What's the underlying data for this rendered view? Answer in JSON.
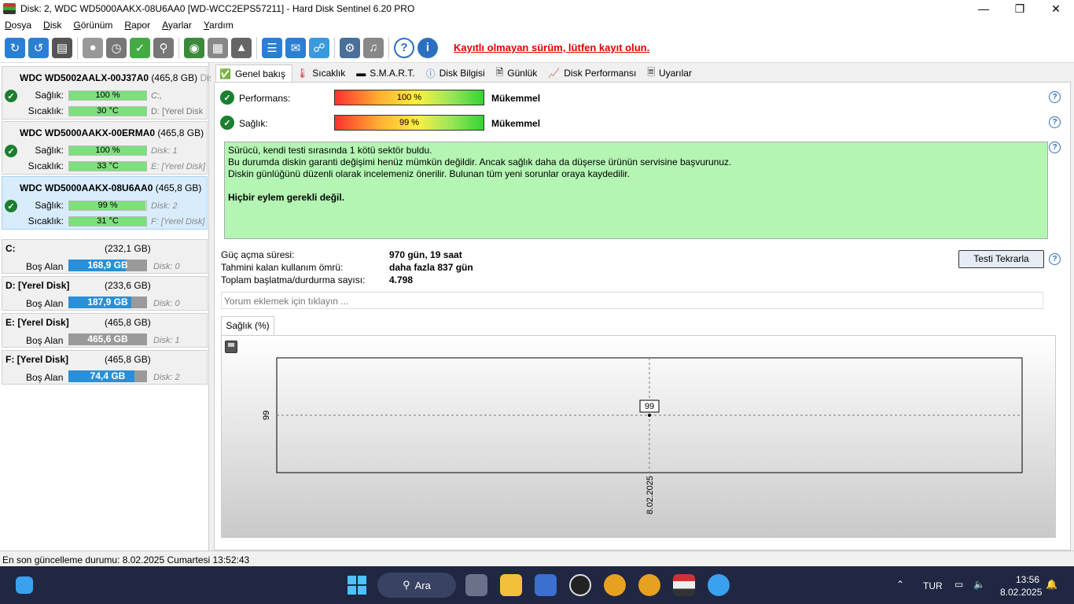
{
  "window": {
    "title": "Disk: 2, WDC WD5000AAKX-08U6AA0 [WD-WCC2EPS57211]  -  Hard Disk Sentinel 6.20 PRO"
  },
  "menu": [
    "Dosya",
    "Disk",
    "Görünüm",
    "Rapor",
    "Ayarlar",
    "Yardım"
  ],
  "toolbar": {
    "register_notice": "Kayıtlı olmayan sürüm, lütfen kayıt olun."
  },
  "labels": {
    "health": "Sağlık:",
    "temp": "Sıcaklık:",
    "free": "Boş Alan"
  },
  "disks": [
    {
      "model": "WDC WD5002AALX-00J37A0",
      "size": "(465,8 GB)",
      "trail": "Dis",
      "health": "100 %",
      "health_pct": 100,
      "temp": "30 °C",
      "side1": "C:,",
      "side2": "D: [Yerel Disk",
      "selected": false
    },
    {
      "model": "WDC WD5000AAKX-00ERMA0",
      "size": "(465,8 GB)",
      "trail": "",
      "health": "100 %",
      "health_pct": 100,
      "temp": "33 °C",
      "side1": "Disk: 1",
      "side2": "E: [Yerel Disk]",
      "selected": false
    },
    {
      "model": "WDC WD5000AAKX-08U6AA0",
      "size": "(465,8 GB)",
      "trail": "",
      "health": "99 %",
      "health_pct": 99,
      "temp": "31 °C",
      "side1": "Disk: 2",
      "side2": "F: [Yerel Disk]",
      "selected": true
    }
  ],
  "volumes": [
    {
      "name": "C:",
      "size": "(232,1 GB)",
      "free": "168,9 GB",
      "free_pct": 73,
      "disk": "Disk: 0"
    },
    {
      "name": "D: [Yerel Disk]",
      "size": "(233,6 GB)",
      "free": "187,9 GB",
      "free_pct": 80,
      "disk": "Disk: 0"
    },
    {
      "name": "E: [Yerel Disk]",
      "size": "(465,8 GB)",
      "free": "465,6 GB",
      "free_pct": 0,
      "disk": "Disk: 1"
    },
    {
      "name": "F: [Yerel Disk]",
      "size": "(465,8 GB)",
      "free": "74,4 GB",
      "free_pct": 84,
      "disk": "Disk: 2"
    }
  ],
  "tabs": [
    "Genel bakış",
    "Sıcaklık",
    "S.M.A.R.T.",
    "Disk Bilgisi",
    "Günlük",
    "Disk Performansı",
    "Uyarılar"
  ],
  "overview": {
    "performance_label": "Performans:",
    "performance_value": "100 %",
    "performance_rating": "Mükemmel",
    "health_label": "Sağlık:",
    "health_value": "99 %",
    "health_rating": "Mükemmel",
    "message": [
      "Sürücü, kendi testi sırasında 1 kötü sektör buldu.",
      "Bu durumda diskin garanti değişimi henüz mümkün değildir. Ancak sağlık daha da düşerse ürünün servisine başvurunuz.",
      "Diskin günlüğünü düzenli olarak incelemeniz önerilir. Bulunan tüm yeni sorunlar oraya kaydedilir."
    ],
    "message_bold": "Hiçbir eylem gerekli değil.",
    "stats": [
      {
        "label": "Güç açma süresi:",
        "value": "970 gün, 19 saat"
      },
      {
        "label": "Tahmini kalan kullanım ömrü:",
        "value": "daha fazla 837 gün"
      },
      {
        "label": "Toplam başlatma/durdurma sayısı:",
        "value": "4.798"
      }
    ],
    "retest_button": "Testi Tekrarla",
    "comment_placeholder": "Yorum eklemek için tıklayın ...",
    "chart_tab": "Sağlık (%)"
  },
  "chart_data": {
    "type": "line",
    "x": [
      "8.02.2025"
    ],
    "series": [
      {
        "values": [
          99
        ]
      }
    ],
    "ytick": "99",
    "data_label": "99"
  },
  "statusbar": {
    "text": "En son güncelleme durumu: 8.02.2025 Cumartesi 13:52:43"
  },
  "taskbar": {
    "search": "Ara",
    "lang": "TUR",
    "time": "13:56",
    "date": "8.02.2025"
  }
}
